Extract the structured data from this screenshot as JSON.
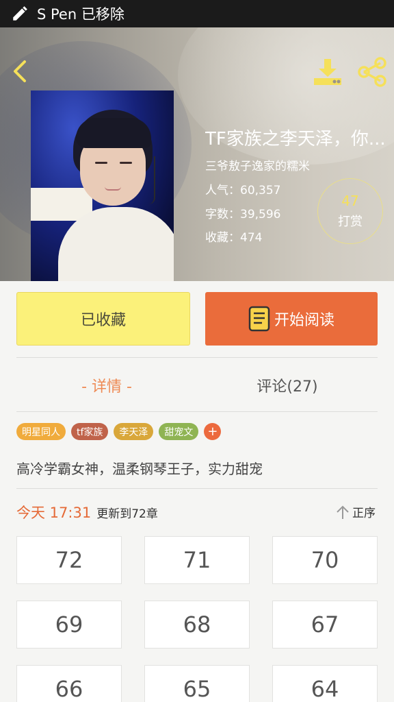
{
  "status_bar": {
    "text": "S Pen 已移除",
    "icon": "pen-icon"
  },
  "header": {
    "back_icon": "chevron-left-icon",
    "download_icon": "download-icon",
    "share_icon": "share-icon",
    "accent_color": "#f5e05a"
  },
  "book": {
    "title": "TF家族之李天泽，你...",
    "author": "三爷敖子逸家的糯米",
    "popularity": "人气：60,357",
    "word_count": "字数：39,596",
    "favorites": "收藏：474"
  },
  "tip": {
    "count": "47",
    "label": "打赏"
  },
  "actions": {
    "favorite_label": "已收藏",
    "favorite_color": "#fbf17a",
    "read_label": "开始阅读",
    "read_color": "#ea6c3b"
  },
  "tabs": {
    "detail": "- 详情 -",
    "comments": "评论(27)"
  },
  "tags": [
    {
      "label": "明星同人",
      "color": "#f0ab3c"
    },
    {
      "label": "tf家族",
      "color": "#c0634a"
    },
    {
      "label": "李天泽",
      "color": "#d9a73a"
    },
    {
      "label": "甜宠文",
      "color": "#8fb453"
    }
  ],
  "tag_add": {
    "label": "+",
    "color": "#ec6a3e"
  },
  "description": "高冷学霸女神，温柔钢琴王子，实力甜宠",
  "update": {
    "time": "今天 17:31",
    "info": "更新到72章",
    "sort_label": "正序",
    "sort_icon": "arrow-up-icon"
  },
  "chapters": [
    "72",
    "71",
    "70",
    "69",
    "68",
    "67",
    "66",
    "65",
    "64"
  ]
}
